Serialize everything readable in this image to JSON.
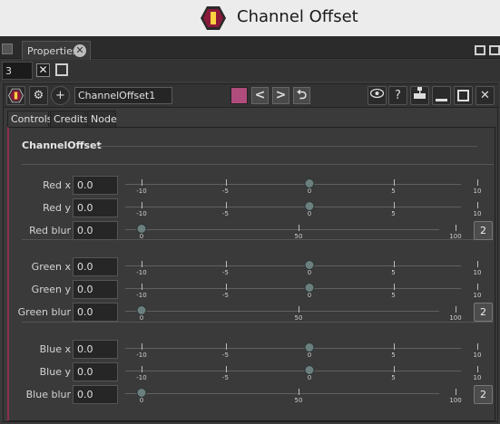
{
  "window": {
    "title": "Channel Offset"
  },
  "dock": {
    "tab_label": "Properties",
    "close_glyph": "✕"
  },
  "toolbar": {
    "max_panels_value": "3",
    "close_glyph": "✕"
  },
  "node": {
    "name": "ChannelOffset1",
    "color": "#b04c7c",
    "prev_glyph": "<",
    "next_glyph": ">",
    "undo_glyph": "⮌",
    "help_glyph": "?",
    "close_glyph": "✕"
  },
  "tabs": [
    "Controls",
    "Credits",
    "Node"
  ],
  "section": {
    "title": "ChannelOffset"
  },
  "groups": [
    {
      "rows": [
        {
          "label": "Red x",
          "value": "0.0",
          "slider": "offset",
          "knob": 0
        },
        {
          "label": "Red y",
          "value": "0.0",
          "slider": "offset",
          "knob": 0
        },
        {
          "label": "Red blur",
          "value": "0.0",
          "slider": "blur",
          "knob": 0,
          "badge": "2"
        }
      ]
    },
    {
      "rows": [
        {
          "label": "Green x",
          "value": "0.0",
          "slider": "offset",
          "knob": 0
        },
        {
          "label": "Green y",
          "value": "0.0",
          "slider": "offset",
          "knob": 0
        },
        {
          "label": "Green blur",
          "value": "0.0",
          "slider": "blur",
          "knob": 0,
          "badge": "2"
        }
      ]
    },
    {
      "rows": [
        {
          "label": "Blue x",
          "value": "0.0",
          "slider": "offset",
          "knob": 0
        },
        {
          "label": "Blue y",
          "value": "0.0",
          "slider": "offset",
          "knob": 0
        },
        {
          "label": "Blue blur",
          "value": "0.0",
          "slider": "blur",
          "knob": 0,
          "badge": "2"
        }
      ]
    }
  ],
  "sliders": {
    "offset": {
      "min": -10,
      "max": 10,
      "ticks": [
        "-10",
        "-5",
        "0",
        "5",
        "10"
      ]
    },
    "blur": {
      "min": 0,
      "max": 100,
      "ticks": [
        "0",
        "50",
        "100"
      ]
    }
  }
}
